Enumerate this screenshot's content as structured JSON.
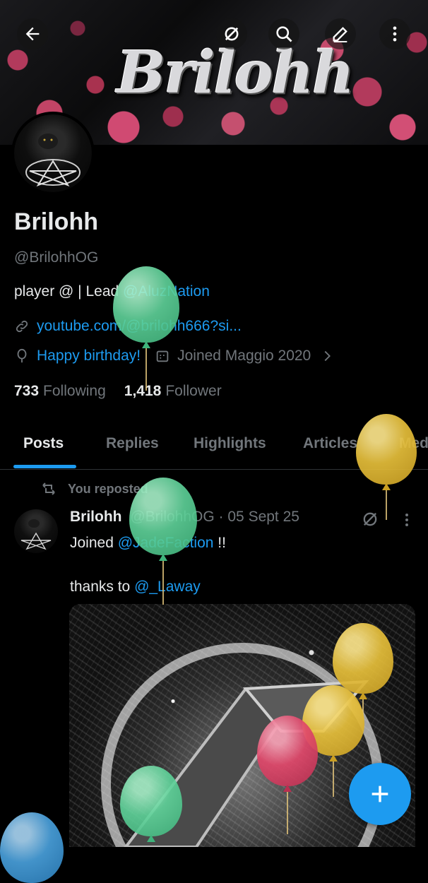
{
  "banner": {
    "title": "Brilohh"
  },
  "profile": {
    "name": "Brilohh",
    "handle": "@BrilohhOG",
    "bio_prefix": "player @ | Lead ",
    "bio_mention": "@AluzNation",
    "website": "youtube.com/@brilohh666?si...",
    "birthday": "Happy birthday!",
    "joined": "Joined Maggio 2020",
    "following_count": "733",
    "following_label": "Following",
    "follower_count": "1,418",
    "follower_label": "Follower"
  },
  "tabs": [
    "Posts",
    "Replies",
    "Highlights",
    "Articles",
    "Med"
  ],
  "post": {
    "repost_label": "You reposted",
    "author": "Brilohh",
    "handle": "@BrilohhOG",
    "date": "· 05 Sept 25",
    "line1_prefix": "Joined ",
    "line1_mention": "@JadeFaction",
    "line1_suffix": " !!",
    "line2_prefix": "thanks to ",
    "line2_mention": "@_Laway"
  },
  "icons": {
    "back": "back-arrow-icon",
    "grok": "grok-icon",
    "search": "search-icon",
    "edit": "edit-icon",
    "more": "more-vertical-icon",
    "link": "link-icon",
    "birthday": "balloon-icon",
    "calendar": "calendar-icon",
    "repost": "repost-icon",
    "compose": "plus-icon"
  },
  "colors": {
    "accent": "#1d9bf0",
    "text": "#e7e9ea",
    "muted": "#71767b",
    "balloon_green": "#5fd39a",
    "balloon_yellow": "#e6bf3a",
    "balloon_red": "#e0476a",
    "balloon_blue": "#4aa3e0"
  }
}
